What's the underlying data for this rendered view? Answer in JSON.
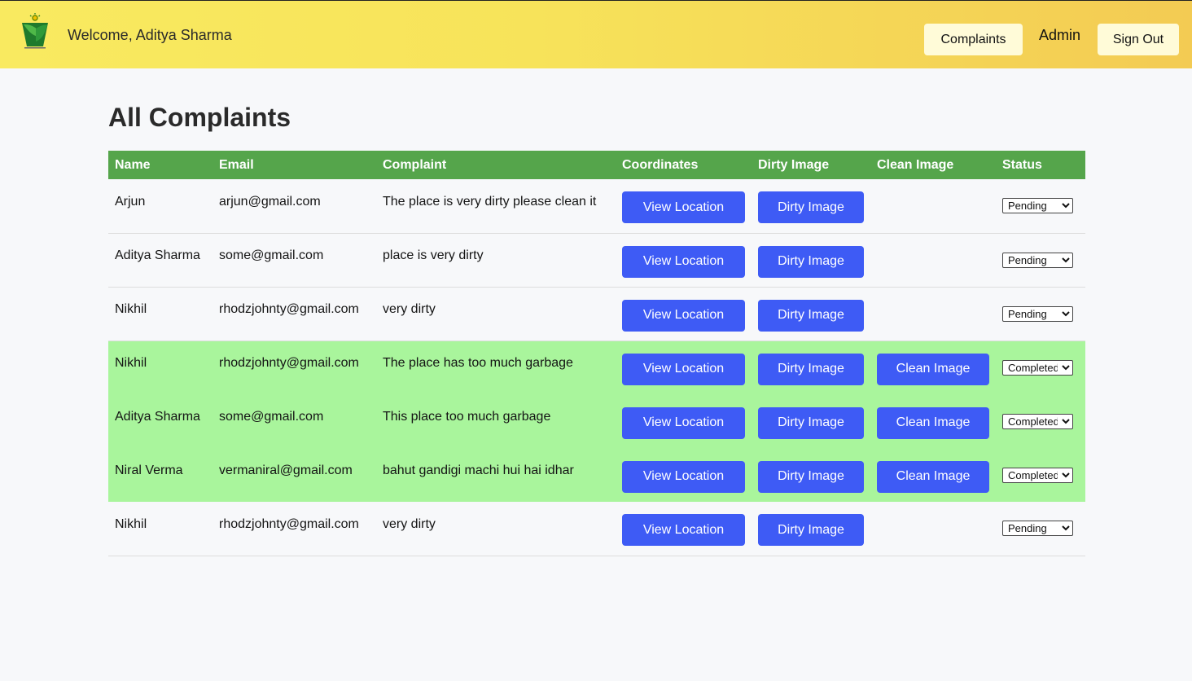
{
  "header": {
    "welcome": "Welcome, Aditya Sharma",
    "complaints_label": "Complaints",
    "admin_label": "Admin",
    "signout_label": "Sign Out"
  },
  "page": {
    "title": "All Complaints"
  },
  "table": {
    "columns": [
      "Name",
      "Email",
      "Complaint",
      "Coordinates",
      "Dirty Image",
      "Clean Image",
      "Status"
    ],
    "view_location_label": "View Location",
    "dirty_image_label": "Dirty Image",
    "clean_image_label": "Clean Image",
    "rows": [
      {
        "name": "Arjun",
        "email": "arjun@gmail.com",
        "complaint": "The place is very dirty please clean it",
        "status": "Pending",
        "has_clean": false
      },
      {
        "name": "Aditya Sharma",
        "email": "some@gmail.com",
        "complaint": "place is very dirty",
        "status": "Pending",
        "has_clean": false
      },
      {
        "name": "Nikhil",
        "email": "rhodzjohnty@gmail.com",
        "complaint": "very dirty",
        "status": "Pending",
        "has_clean": false
      },
      {
        "name": "Nikhil",
        "email": "rhodzjohnty@gmail.com",
        "complaint": "The place has too much garbage",
        "status": "Completed",
        "has_clean": true
      },
      {
        "name": "Aditya Sharma",
        "email": "some@gmail.com",
        "complaint": "This place too much garbage",
        "status": "Completed",
        "has_clean": true
      },
      {
        "name": "Niral Verma",
        "email": "vermaniral@gmail.com",
        "complaint": "bahut gandigi machi hui hai idhar",
        "status": "Completed",
        "has_clean": true
      },
      {
        "name": "Nikhil",
        "email": "rhodzjohnty@gmail.com",
        "complaint": "very dirty",
        "status": "Pending",
        "has_clean": false
      }
    ]
  },
  "colors": {
    "header_gradient_start": "#f9ea60",
    "header_gradient_end": "#f3cb53",
    "table_header": "#55a54b",
    "completed_row": "#a9f59c",
    "action_button": "#3e5bf5"
  },
  "icons": {
    "logo": "leaf-basket-logo"
  }
}
